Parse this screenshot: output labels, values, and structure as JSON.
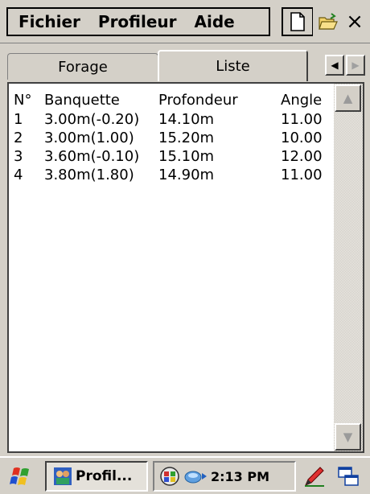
{
  "menu": {
    "fichier": "Fichier",
    "profileur": "Profileur",
    "aide": "Aide"
  },
  "toolbar": {
    "new_icon": "new-document-icon",
    "open_icon": "open-folder-icon",
    "close_glyph": "×"
  },
  "tabs": [
    {
      "label": "Forage",
      "active": false
    },
    {
      "label": "Liste",
      "active": true
    }
  ],
  "list": {
    "headers": [
      "N°",
      "Banquette",
      "Profondeur",
      "Angle"
    ],
    "rows": [
      [
        "1",
        "3.00m(-0.20)",
        "14.10m",
        "11.00"
      ],
      [
        "2",
        "3.00m(1.00)",
        "15.20m",
        "10.00"
      ],
      [
        "3",
        "3.60m(-0.10)",
        "15.10m",
        "12.00"
      ],
      [
        "4",
        "3.80m(1.80)",
        "14.90m",
        "11.00"
      ]
    ]
  },
  "taskbar": {
    "task_label": "Profil...",
    "clock": "2:13 PM"
  },
  "colors": {
    "chrome": "#d4d0c8",
    "list_bg": "#ffffff",
    "text": "#000000"
  }
}
